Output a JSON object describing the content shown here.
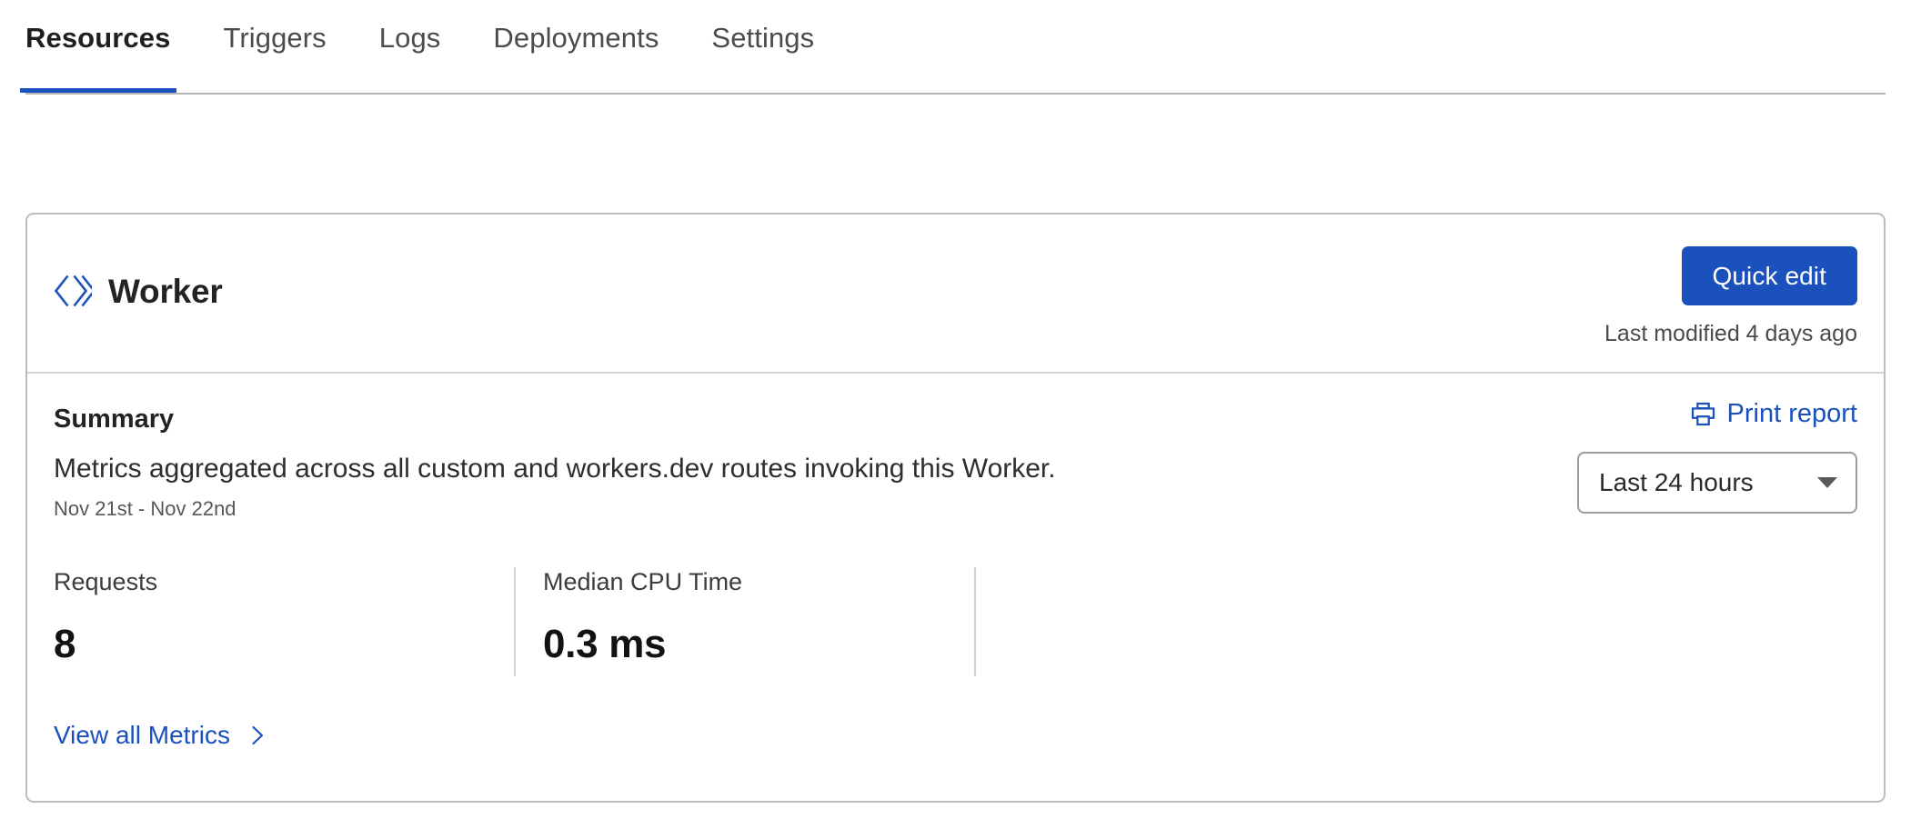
{
  "tabs": {
    "items": [
      {
        "label": "Resources",
        "active": true
      },
      {
        "label": "Triggers",
        "active": false
      },
      {
        "label": "Logs",
        "active": false
      },
      {
        "label": "Deployments",
        "active": false
      },
      {
        "label": "Settings",
        "active": false
      }
    ]
  },
  "card": {
    "header": {
      "icon": "code-brackets-icon",
      "title": "Worker",
      "quick_edit_label": "Quick edit",
      "last_modified": "Last modified 4 days ago"
    },
    "summary": {
      "heading": "Summary",
      "print_report_label": "Print report",
      "print_report_icon": "printer-icon",
      "description": "Metrics aggregated across all custom and workers.dev routes invoking this Worker.",
      "date_range_text": "Nov 21st - Nov 22nd",
      "range_selector": {
        "selected": "Last 24 hours",
        "icon": "chevron-down-icon"
      },
      "stats": [
        {
          "label": "Requests",
          "value": "8"
        },
        {
          "label": "Median CPU Time",
          "value": "0.3 ms"
        }
      ],
      "view_all_label": "View all Metrics",
      "view_all_icon": "chevron-right-icon"
    }
  },
  "colors": {
    "accent_blue": "#1b51bd",
    "border_grey": "#bcbcbc",
    "divider_grey": "#d4d4d4",
    "text_dark": "#232323",
    "text_muted": "#4b4b4b"
  }
}
